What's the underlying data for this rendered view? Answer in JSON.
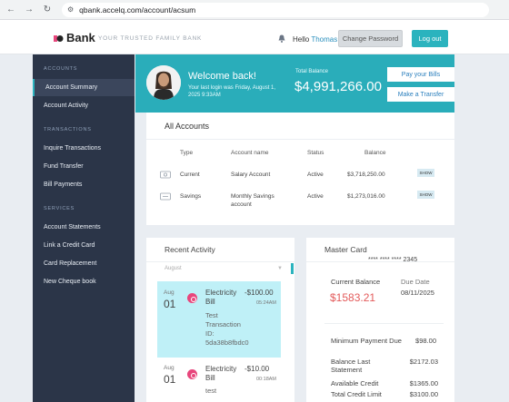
{
  "browser": {
    "url": "qbank.accelq.com/account/acsum"
  },
  "header": {
    "logo_text": "Bank",
    "tagline": "YOUR TRUSTED FAMILY BANK",
    "greeting": "Hello",
    "username": "Thomas",
    "change_password_label": "Change Password",
    "logout_label": "Log out"
  },
  "sidebar": {
    "sections": [
      {
        "title": "ACCOUNTS",
        "items": [
          "Account Summary",
          "Account Activity"
        ]
      },
      {
        "title": "TRANSACTIONS",
        "items": [
          "Inquire Transactions",
          "Fund Transfer",
          "Bill Payments"
        ]
      },
      {
        "title": "SERVICES",
        "items": [
          "Account Statements",
          "Link a Credit Card",
          "Card Replacement",
          "New Cheque book"
        ]
      }
    ],
    "active_item": "Account Summary"
  },
  "welcome": {
    "title": "Welcome back!",
    "last_login": "Your last login was Friday, August 1, 2025 9:33AM",
    "total_balance_label": "Total Balance",
    "total_balance_value": "$4,991,266.00",
    "pay_bills_label": "Pay your Bills",
    "make_transfer_label": "Make a Transfer"
  },
  "accounts": {
    "title": "All Accounts",
    "columns": [
      "Type",
      "Account name",
      "Status",
      "Balance"
    ],
    "rows": [
      {
        "type": "Current",
        "name": "Salary Account",
        "status": "Active",
        "balance": "$3,718,250.00",
        "action": "SHOW",
        "icon": "wallet-icon"
      },
      {
        "type": "Savings",
        "name": "Monthly Savings account",
        "status": "Active",
        "balance": "$1,273,016.00",
        "action": "SHOW",
        "icon": "piggy-bank-icon"
      }
    ]
  },
  "recent_activity": {
    "title": "Recent Activity",
    "month_filter": "August",
    "items": [
      {
        "month": "Aug",
        "day": "01",
        "title": "Electricity Bill",
        "amount": "-$100.00",
        "time": "05:24AM",
        "description": "Test Transaction ID:",
        "transaction_id": "5da38b8fbdc0"
      },
      {
        "month": "Aug",
        "day": "01",
        "title": "Electricity Bill",
        "amount": "-$10.00",
        "time": "00:18AM",
        "description": "test"
      }
    ]
  },
  "master_card": {
    "title": "Master Card",
    "card_number": "**** **** **** 2345",
    "current_balance_label": "Current Balance",
    "current_balance": "$1583.21",
    "due_date_label": "Due Date",
    "due_date": "08/11/2025",
    "details": [
      {
        "label": "Minimum Payment Due",
        "value": "$98.00"
      },
      {
        "label": "Balance Last Statement",
        "value": "$2172.03"
      },
      {
        "label": "Available Credit",
        "value": "$1365.00"
      },
      {
        "label": "Total Credit Limit",
        "value": "$3100.00"
      }
    ]
  },
  "colors": {
    "accent": "#2bb3be",
    "sidebar": "#2b3548",
    "negative": "#e35a5a",
    "link": "#2a8fbd"
  }
}
